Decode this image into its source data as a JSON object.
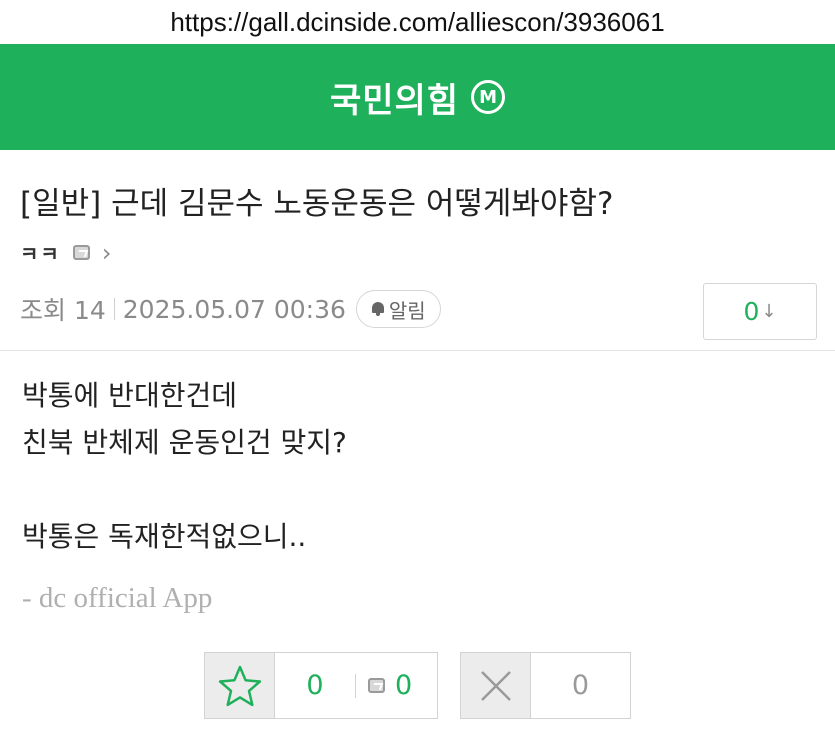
{
  "url_bar": {
    "url": "https://gall.dcinside.com/alliescon/3936061"
  },
  "gallery": {
    "title": "국민의힘",
    "badge": "M"
  },
  "post": {
    "title": "[일반] 근데 김문수 노동운동은 어떻게봐야함?",
    "author": "ㅋㅋ",
    "views_label": "조회 14",
    "datetime": "2025.05.07 00:36",
    "notify_label": "알림",
    "comment_count": "0",
    "body_lines": [
      "박통에 반대한건데",
      "친북 반체제 운동인건 맞지?",
      "박통은 독재한적없으니.."
    ],
    "signature": "- dc official App"
  },
  "recommend": {
    "recommend_count": "0",
    "app_recommend_count": "0",
    "nonrecommend_count": "0"
  },
  "colors": {
    "brand_green": "#1fb05b"
  },
  "icons": [
    "minor-gallery-badge-icon",
    "app-icon",
    "chevron-right-icon",
    "bell-icon",
    "down-arrow-icon",
    "star-icon",
    "close-x-icon"
  ]
}
